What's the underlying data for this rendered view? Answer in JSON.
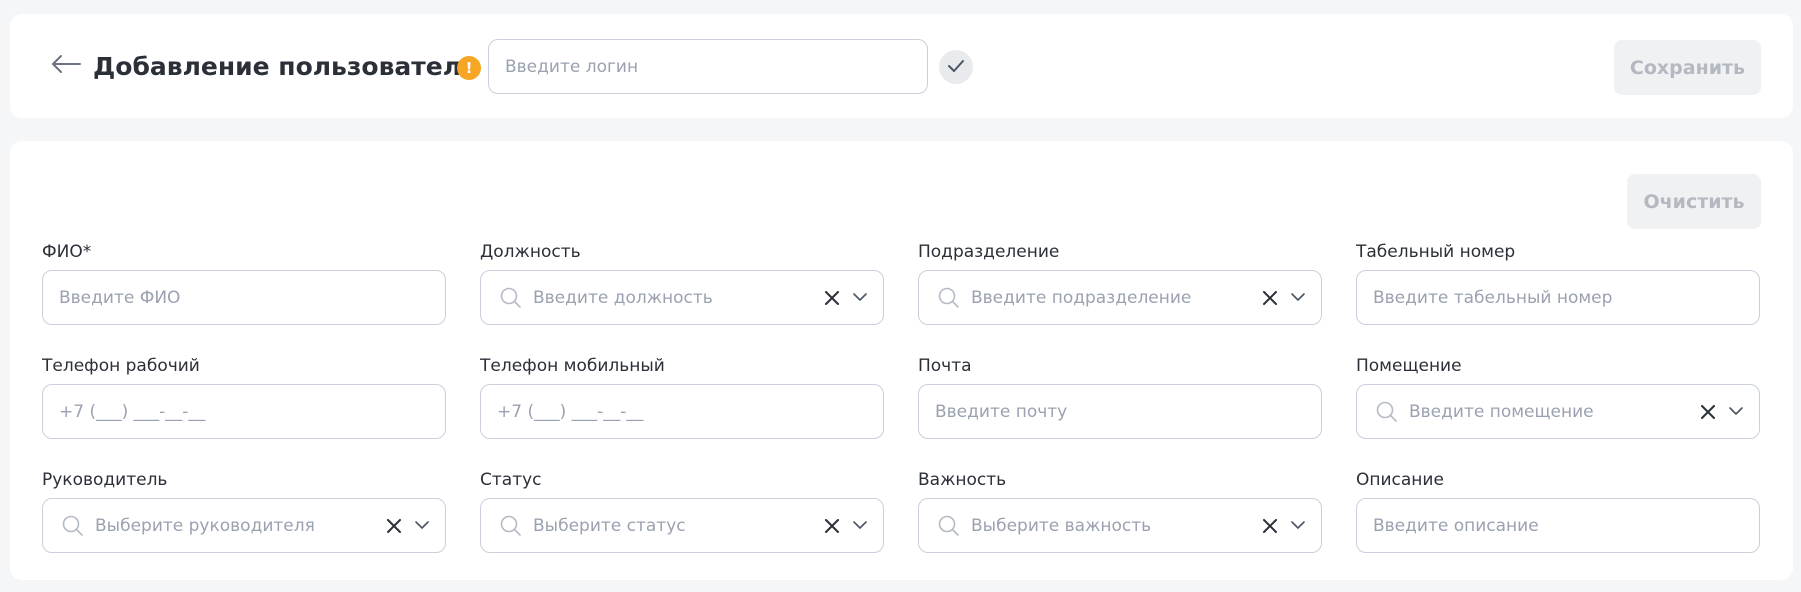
{
  "header": {
    "title": "Добавление пользователя",
    "warning_glyph": "!",
    "login_placeholder": "Введите логин",
    "save_label": "Сохранить"
  },
  "form": {
    "clear_label": "Очистить",
    "fields": [
      {
        "label": "ФИО*",
        "placeholder": "Введите ФИО"
      },
      {
        "label": "Должность",
        "placeholder": "Введите должность"
      },
      {
        "label": "Подразделение",
        "placeholder": "Введите подразделение"
      },
      {
        "label": "Табельный номер",
        "placeholder": "Введите табельный номер"
      },
      {
        "label": "Телефон рабочий",
        "placeholder": "+7 (___) ___-__-__"
      },
      {
        "label": "Телефон мобильный",
        "placeholder": "+7 (___) ___-__-__"
      },
      {
        "label": "Почта",
        "placeholder": "Введите почту"
      },
      {
        "label": "Помещение",
        "placeholder": "Введите помещение"
      },
      {
        "label": "Руководитель",
        "placeholder": "Выберите руководителя"
      },
      {
        "label": "Статус",
        "placeholder": "Выберите статус"
      },
      {
        "label": "Важность",
        "placeholder": "Выберите важность"
      },
      {
        "label": "Описание",
        "placeholder": "Введите описание"
      }
    ]
  },
  "icons": {
    "back": "arrow-left-icon",
    "warning": "warning-icon",
    "confirm": "check-icon",
    "search": "search-icon",
    "clear": "close-icon",
    "expand": "chevron-down-icon"
  },
  "colors": {
    "warning": "#f6a623",
    "border": "#c9d0dc",
    "placeholder": "#9aa1b0",
    "disabled_button_bg": "#f0f1f3",
    "disabled_button_text": "#b4b8c0"
  }
}
